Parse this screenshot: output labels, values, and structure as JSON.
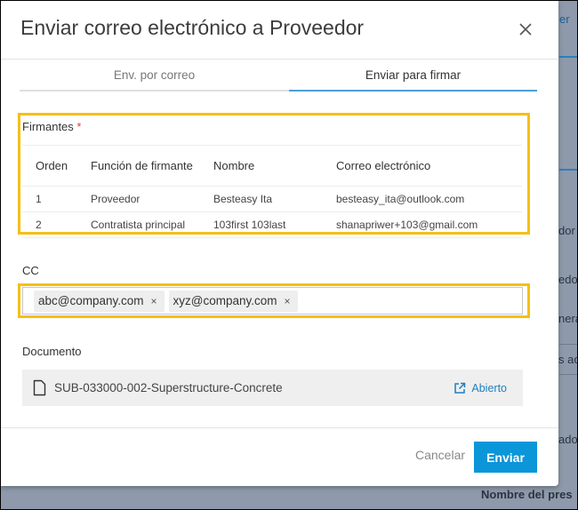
{
  "background": {
    "fragments": [
      "er",
      "dor",
      "edo",
      "nera",
      "s ac",
      "ado",
      "Nombre del pres"
    ]
  },
  "dialog": {
    "title": "Enviar correo electrónico a Proveedor",
    "tabs": [
      {
        "label": "Env. por correo",
        "active": false
      },
      {
        "label": "Enviar para firmar",
        "active": true
      }
    ],
    "signers": {
      "label": "Firmantes",
      "required_mark": "*",
      "columns": [
        "Orden",
        "Función de firmante",
        "Nombre",
        "Correo electrónico"
      ],
      "rows": [
        [
          "1",
          "Proveedor",
          "Besteasy Ita",
          "besteasy_ita@outlook.com"
        ],
        [
          "2",
          "Contratista principal",
          "103first 103last",
          "shanapriwer+103@gmail.com"
        ]
      ]
    },
    "cc": {
      "label": "CC",
      "chips": [
        "abc@company.com",
        "xyz@company.com"
      ],
      "remove_glyph": "×"
    },
    "document": {
      "label": "Documento",
      "name": "SUB-033000-002-Superstructure-Concrete",
      "open_label": "Abierto"
    },
    "footer": {
      "cancel_label": "Cancelar",
      "send_label": "Enviar"
    },
    "colors": {
      "accent": "#0a96d8",
      "highlight": "#f5bf17",
      "link": "#1f7fc1"
    }
  }
}
